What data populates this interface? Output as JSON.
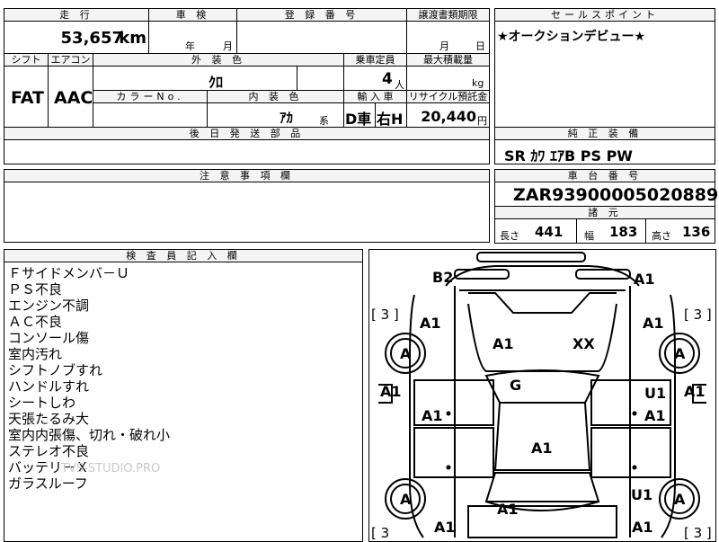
{
  "top": {
    "mileage_label": "走 行",
    "mileage_value": "53,657",
    "mileage_unit": "km",
    "inspection_label": "車 検",
    "inspection_year": "年",
    "inspection_month": "月",
    "registration_label": "登 録 番 号",
    "transfer_label": "譲渡書類期限",
    "transfer_month": "月",
    "transfer_day": "日"
  },
  "sales_point": {
    "label": "セールスポイント",
    "text": "★オークションデビュー★"
  },
  "spec": {
    "shift_label": "シフト",
    "shift_value": "FAT",
    "ac_label": "エアコン",
    "ac_value": "AAC",
    "ext_color_label": "外 装 色",
    "ext_color_value": "ｸﾛ",
    "capacity_label": "乗車定員",
    "capacity_value": "4",
    "capacity_unit": "人",
    "max_load_label": "最大積載量",
    "max_load_unit": "kg",
    "color_no_label": "カラーNo.",
    "int_color_label": "内 装 色",
    "int_color_value": "ｱｶ",
    "int_color_suffix": "系",
    "import_label": "輸 入 車",
    "import_value_1": "D車",
    "import_value_2": "右H",
    "recycle_label": "リサイクル預託金",
    "recycle_value": "20,440",
    "recycle_unit": "円"
  },
  "later_parts_label": "後 日 発 送 部 品",
  "genuine_equipment": {
    "label": "純 正 装 備",
    "value": "SR ｶﾜ ｴｱB PS PW"
  },
  "caution_label": "注 意 事 項 欄",
  "chassis": {
    "label": "車 台 番 号",
    "value": "ZAR93900005020889",
    "dims_label": "諸 元",
    "length_label": "長さ",
    "length_value": "441",
    "width_label": "幅",
    "width_value": "183",
    "height_label": "高さ",
    "height_value": "136"
  },
  "inspector": {
    "label": "検 査 員 記 入 欄",
    "remarks": [
      "Ｆサイドメンバ－Ｕ",
      "ＰＳ不良",
      "エンジン不調",
      "ＡＣ不良",
      "コンソール傷",
      "室内汚れ",
      "シフトノブすれ",
      "ハンドルすれ",
      "シートしわ",
      "天張たるみ大",
      "室内内張傷、切れ・破れ小",
      "ステレオ不良",
      "バッテリ－Ｘ",
      "ガラスルーフ"
    ],
    "watermark": "TVS-STUDIO.PRO"
  },
  "damage_map": {
    "b2": "B2",
    "a1_tr": "A1",
    "bracket_lt": "[ 3 ]",
    "bracket_rt": "[ 3 ]",
    "bracket_lb": "[ 3",
    "bracket_rb": "[ 3 ]",
    "a1_fl": "A1",
    "a1_fr": "A1",
    "a1_hood": "A1",
    "xx_hood": "XX",
    "a_wheel_fl": "A",
    "a_wheel_fr": "A",
    "g_windshield": "G",
    "a1_left_edge": "A1",
    "a1_left_door1": "A1",
    "u1_right_door1": "U1",
    "a1_right_edge": "A1",
    "a1_right_door1": "A1",
    "a1_roof": "A1",
    "a_wheel_rl": "A",
    "u1_rr": "U1",
    "a_wheel_rr": "A",
    "a1_rear_center": "A1",
    "a1_rl": "A1",
    "a1_rr": "A1"
  }
}
